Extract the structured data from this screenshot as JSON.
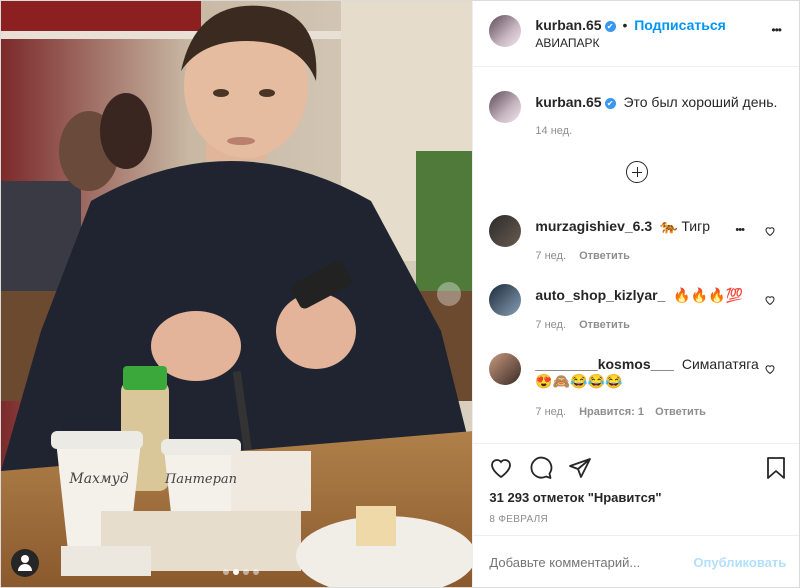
{
  "post": {
    "username": "kurban.65",
    "verified_mark": "✔",
    "follow_label": "Подписаться",
    "location": "АВИАПАРК",
    "more_label": "•••",
    "caption_username": "kurban.65",
    "caption_text": "Это был хороший день.",
    "caption_age": "14 нед."
  },
  "photo": {
    "cup1_text": "Махмуд",
    "cup2_text": "Пантерап",
    "indicator_dots": 4,
    "active_dot": 2
  },
  "comments": [
    {
      "username": "murzagishiev_6.3",
      "text": "🐅 Тигр",
      "age": "7 нед.",
      "likes": "",
      "reply": "Ответить",
      "more": "•••"
    },
    {
      "username": "auto_shop_kizlyar_",
      "text": "🔥🔥🔥💯",
      "age": "7 нед.",
      "likes": "",
      "reply": "Ответить"
    },
    {
      "username": "________kosmos___",
      "text": "Симапатяга",
      "text2": "😍🙈😂😂😂",
      "age": "7 нед.",
      "likes": "Нравится: 1",
      "reply": "Ответить"
    }
  ],
  "engagement": {
    "likes_text": "31 293 отметок \"Нравится\"",
    "date": "8 ФЕВРАЛЯ"
  },
  "comment_box": {
    "placeholder": "Добавьте комментарий...",
    "publish_label": "Опубликовать"
  },
  "colors": {
    "accent": "#0095f6",
    "muted": "#8e8e8e",
    "text": "#262626",
    "border": "#efefef"
  }
}
